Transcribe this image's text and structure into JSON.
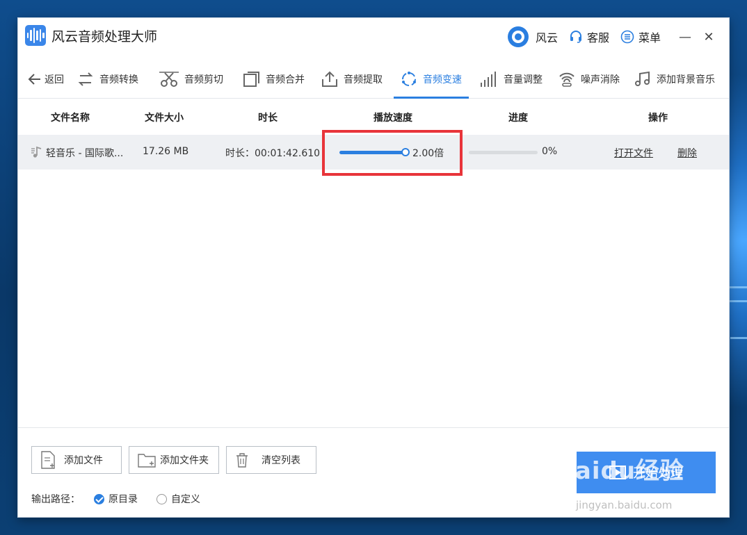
{
  "app": {
    "title": "风云音频处理大师"
  },
  "titlebar": {
    "brand_label": "风云",
    "service_label": "客服",
    "menu_label": "菜单",
    "minimize": "—",
    "close": "✕"
  },
  "toolbar": {
    "back": "返回",
    "tools": [
      "音频转换",
      "音频剪切",
      "音频合并",
      "音频提取",
      "音频变速",
      "音量调整",
      "噪声消除",
      "添加背景音乐"
    ],
    "active": "音频变速"
  },
  "table": {
    "headers": [
      "文件名称",
      "文件大小",
      "时长",
      "播放速度",
      "进度",
      "操作"
    ],
    "rows": [
      {
        "name": "轻音乐 - 国际歌...",
        "size": "17.26 MB",
        "duration": "时长：00:01:42.610",
        "speed": "2.00倍",
        "speed_slider_fraction": 1.0,
        "progress": "0%",
        "progress_fraction": 0,
        "open_label": "打开文件",
        "delete_label": "删除"
      }
    ]
  },
  "footer": {
    "add_file": "添加文件",
    "add_folder": "添加文件夹",
    "clear_list": "清空列表",
    "output_label": "输出路径：",
    "opt_original": "原目录",
    "opt_custom": "自定义",
    "start": "开始处理"
  },
  "watermark": {
    "brand": "Baidu经验",
    "url": "jingyan.baidu.com"
  },
  "colors": {
    "accent": "#2b7fe0",
    "highlight": "#e8343a",
    "start_button": "#3f8df0"
  }
}
